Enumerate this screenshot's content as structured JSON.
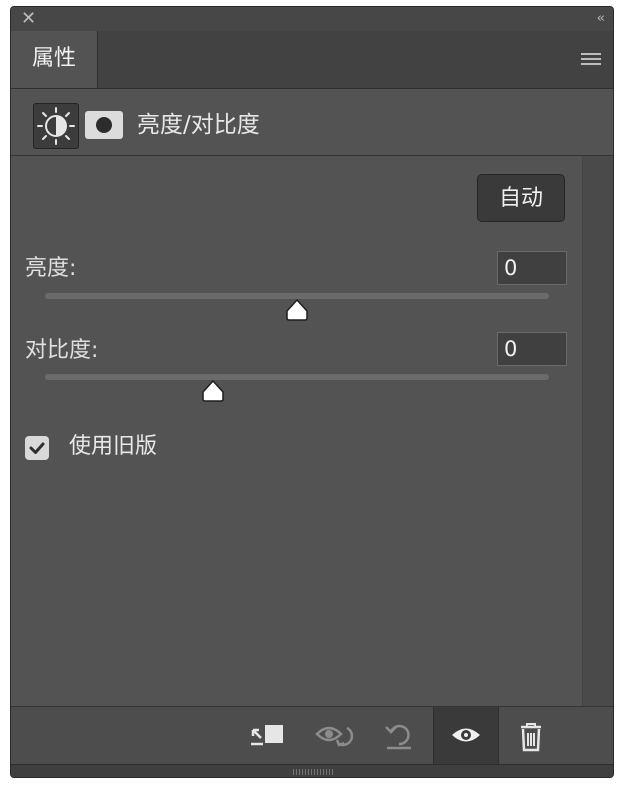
{
  "window": {
    "close_icon": "close-icon",
    "collapse_glyph": "‹‹",
    "collapse_icon": "double-chevron-left-icon"
  },
  "tabs": [
    {
      "label": "属性",
      "active": true
    }
  ],
  "panel_menu_icon": "hamburger-menu-icon",
  "header": {
    "adjustment_icon": "brightness-contrast-icon",
    "mask_icon": "layer-mask-icon",
    "title": "亮度/对比度"
  },
  "controls": {
    "auto_label": "自动",
    "brightness": {
      "label": "亮度:",
      "value": "0",
      "min": -150,
      "max": 150,
      "current": 0
    },
    "contrast": {
      "label": "对比度:",
      "value": "0",
      "min": -50,
      "max": 100,
      "current": 0
    },
    "use_legacy": {
      "label": "使用旧版",
      "checked": true
    }
  },
  "footer": {
    "buttons": [
      {
        "icon": "clip-to-layer-icon",
        "active": false
      },
      {
        "icon": "view-previous-state-icon",
        "active": false
      },
      {
        "icon": "reset-icon",
        "active": false
      },
      {
        "icon": "toggle-visibility-icon",
        "active": true
      },
      {
        "icon": "trash-icon",
        "active": false
      }
    ]
  },
  "colors": {
    "panel_bg": "#535353",
    "tab_bar_bg": "#424242",
    "text": "#e6e6e6"
  }
}
